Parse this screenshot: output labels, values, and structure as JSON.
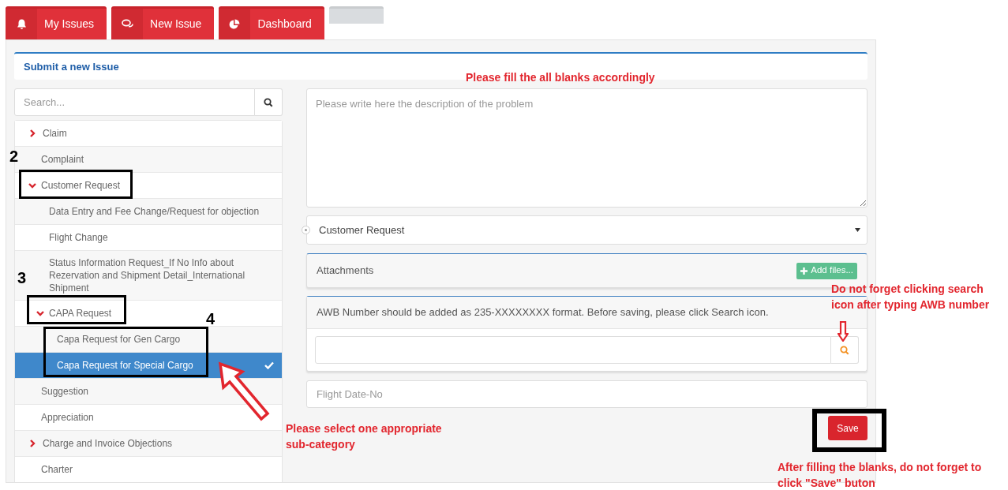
{
  "tabs": [
    {
      "kind": "bell",
      "label": "My Issues"
    },
    {
      "kind": "comments",
      "label": "New Issue"
    },
    {
      "kind": "chart",
      "label": "Dashboard"
    },
    {
      "kind": "blank"
    }
  ],
  "panel": {
    "title": "Submit a new Issue"
  },
  "search": {
    "placeholder": "Search..."
  },
  "categories": [
    {
      "kind": "group",
      "label": "Claim",
      "expanded": false,
      "selected": false
    },
    {
      "kind": "leaf",
      "label": "Complaint",
      "selected": false
    },
    {
      "kind": "group",
      "label": "Customer Request",
      "expanded": true,
      "selected": false,
      "children": [
        {
          "kind": "leaf",
          "label": "Data Entry and Fee Change/Request for objection",
          "selected": false
        },
        {
          "kind": "leaf",
          "label": "Flight Change",
          "selected": false
        },
        {
          "kind": "leaf",
          "label": "Status Information Request_If No Info about Rezervation and Shipment Detail_International Shipment",
          "selected": false
        },
        {
          "kind": "group",
          "label": "CAPA Request",
          "expanded": true,
          "selected": false,
          "children": [
            {
              "kind": "leaf",
              "label": "Capa Request for Gen Cargo",
              "selected": false
            },
            {
              "kind": "leaf",
              "label": "Capa Request for Special Cargo",
              "selected": true
            }
          ]
        }
      ]
    },
    {
      "kind": "leaf",
      "label": "Suggestion",
      "selected": false
    },
    {
      "kind": "leaf",
      "label": "Appreciation",
      "selected": false
    },
    {
      "kind": "group",
      "label": "Charge and Invoice Objections",
      "expanded": false,
      "selected": false
    },
    {
      "kind": "leaf",
      "label": "Charter",
      "selected": false
    }
  ],
  "description": {
    "placeholder": "Please write here the description of the problem"
  },
  "category_select": {
    "value": "Customer Request"
  },
  "attachments": {
    "title": "Attachments",
    "button": "Add files..."
  },
  "awb": {
    "hint": "AWB Number should be added as 235-XXXXXXXX format. Before saving, please click Search icon."
  },
  "flight": {
    "placeholder": "Flight Date-No"
  },
  "save_button": "Save",
  "annotations": [
    {
      "kind": "number",
      "text": "2"
    },
    {
      "kind": "number",
      "text": "3"
    },
    {
      "kind": "number",
      "text": "4"
    },
    {
      "kind": "note",
      "text": "Please fill the all blanks accordingly"
    },
    {
      "kind": "note",
      "text": "Please select one appropriate sub-category"
    },
    {
      "kind": "note",
      "text": "Do not forget clicking search icon after typing AWB number"
    },
    {
      "kind": "note",
      "text": "After filling the blanks, do not forget to click \"Save\" buton"
    }
  ]
}
